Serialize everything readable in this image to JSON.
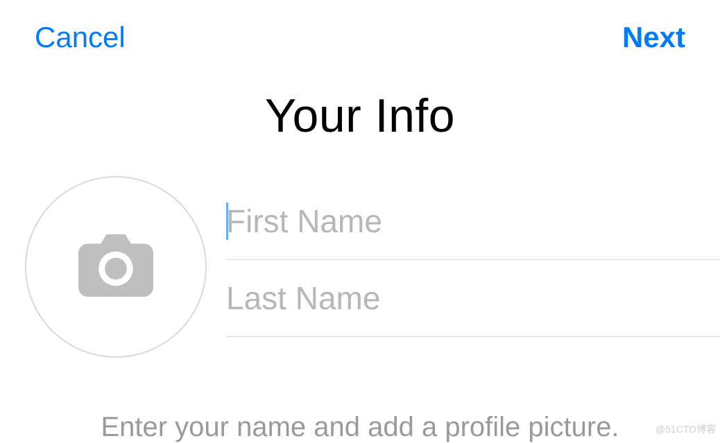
{
  "header": {
    "cancel": "Cancel",
    "next": "Next"
  },
  "title": "Your Info",
  "fields": {
    "first_name_placeholder": "First Name",
    "first_name_value": "",
    "last_name_placeholder": "Last Name",
    "last_name_value": ""
  },
  "hint": "Enter your name and add a profile picture.",
  "watermark": "@51CTO博客",
  "colors": {
    "accent": "#007aff",
    "placeholder": "#b7b7b7",
    "border": "#d9d9d9",
    "icon": "#bfbfbf"
  }
}
